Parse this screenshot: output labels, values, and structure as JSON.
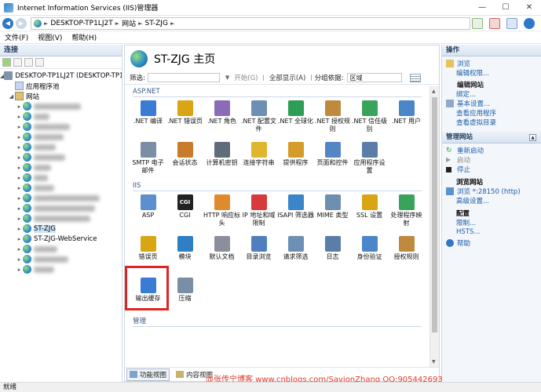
{
  "window": {
    "title": "Internet Information Services (IIS)管理器"
  },
  "address": {
    "crumbs": [
      "DESKTOP-TP1LJ2T",
      "网站",
      "ST-ZJG"
    ]
  },
  "menu": {
    "file": "文件(F)",
    "view": "视图(V)",
    "help": "帮助(H)"
  },
  "connections": {
    "title": "连接",
    "server": "DESKTOP-TP1LJ2T (DESKTOP-TP1",
    "app_pools": "应用程序池",
    "sites": "网站",
    "selected_site": "ST-ZJG",
    "site2": "ST-ZJG-WebService"
  },
  "main": {
    "title": "ST-ZJG 主页",
    "filter_label": "筛选:",
    "start_label": "开始(G)",
    "show_all_label": "全部显示(A)",
    "group_label": "分组依据:",
    "group_value": "区域",
    "section_aspnet": "ASP.NET",
    "section_iis": "IIS",
    "section_manage": "管理",
    "aspnet_items": [
      {
        "label": ".NET 编译",
        "name": "net-compile",
        "color": "#3a7bd5"
      },
      {
        "label": ".NET 错误页",
        "name": "net-error-pages",
        "color": "#d9a514"
      },
      {
        "label": ".NET 角色",
        "name": "net-roles",
        "color": "#8a6bb8"
      },
      {
        "label": ".NET 配置文件",
        "name": "net-profile",
        "color": "#6d8fb3"
      },
      {
        "label": ".NET 全球化",
        "name": "net-globalization",
        "color": "#2e9d55"
      },
      {
        "label": ".NET 授权规则",
        "name": "net-authorization",
        "color": "#c08a3e"
      },
      {
        "label": ".NET 信任级别",
        "name": "net-trust-levels",
        "color": "#3aa35b"
      },
      {
        "label": ".NET 用户",
        "name": "net-users",
        "color": "#4a86c8"
      },
      {
        "label": "SMTP 电子邮件",
        "name": "smtp-email",
        "color": "#7a8ea6"
      },
      {
        "label": "会话状态",
        "name": "session-state",
        "color": "#c97a2b"
      },
      {
        "label": "计算机密钥",
        "name": "machine-key",
        "color": "#5f6c7b"
      },
      {
        "label": "连接字符串",
        "name": "connection-strings",
        "color": "#e0b62e"
      },
      {
        "label": "提供程序",
        "name": "providers",
        "color": "#d69c2a"
      },
      {
        "label": "页面和控件",
        "name": "pages-controls",
        "color": "#5586c4"
      },
      {
        "label": "应用程序设置",
        "name": "app-settings",
        "color": "#5a7ea8"
      }
    ],
    "iis_items": [
      {
        "label": "ASP",
        "name": "asp",
        "color": "#5c8fd0"
      },
      {
        "label": "CGI",
        "name": "cgi",
        "color": "#222222",
        "text": "CGI"
      },
      {
        "label": "HTTP 响应标头",
        "name": "http-response-headers",
        "color": "#e08a2e"
      },
      {
        "label": "IP 地址和域限制",
        "name": "ip-domain-restrictions",
        "color": "#d63a3a"
      },
      {
        "label": "ISAPI 筛选器",
        "name": "isapi-filters",
        "color": "#3a86c8"
      },
      {
        "label": "MIME 类型",
        "name": "mime-types",
        "color": "#6f8fb0"
      },
      {
        "label": "SSL 设置",
        "name": "ssl-settings",
        "color": "#d9a514"
      },
      {
        "label": "处理程序映射",
        "name": "handler-mappings",
        "color": "#3aa35b"
      },
      {
        "label": "错误页",
        "name": "error-pages",
        "color": "#d9a514"
      },
      {
        "label": "模块",
        "name": "modules",
        "color": "#2e7fc4"
      },
      {
        "label": "默认文档",
        "name": "default-document",
        "color": "#8a8f99"
      },
      {
        "label": "目录浏览",
        "name": "directory-browsing",
        "color": "#4f7fbf"
      },
      {
        "label": "请求筛选",
        "name": "request-filtering",
        "color": "#6d8fb3"
      },
      {
        "label": "日志",
        "name": "logging",
        "color": "#5a7ea8"
      },
      {
        "label": "身份验证",
        "name": "authentication",
        "color": "#4a86c8"
      },
      {
        "label": "授权规则",
        "name": "authorization-rules",
        "color": "#c08a3e"
      },
      {
        "label": "输出缓存",
        "name": "output-caching",
        "color": "#3a7bd5"
      },
      {
        "label": "压缩",
        "name": "compression",
        "color": "#7a8ea6"
      }
    ],
    "tab_features": "功能视图",
    "tab_content": "内容视图"
  },
  "actions": {
    "title": "操作",
    "explore": "浏览",
    "edit_permissions": "编辑权限...",
    "edit_site": "编辑网站",
    "bindings": "绑定...",
    "basic_settings": "基本设置...",
    "view_apps": "查看应用程序",
    "view_vdirs": "查看虚拟目录",
    "manage_site": "管理网站",
    "restart": "重新启动",
    "start": "启动",
    "stop": "停止",
    "browse_site": "浏览网站",
    "browse_port": "浏览 *:28150 (http)",
    "advanced": "高级设置...",
    "configure": "配置",
    "limits": "限制...",
    "hsts": "HSTS...",
    "help": "帮助"
  },
  "watermark": "@张传宁博客 www.cnblogs.com/SavionZhang  QQ:905442693",
  "status": "就绪"
}
